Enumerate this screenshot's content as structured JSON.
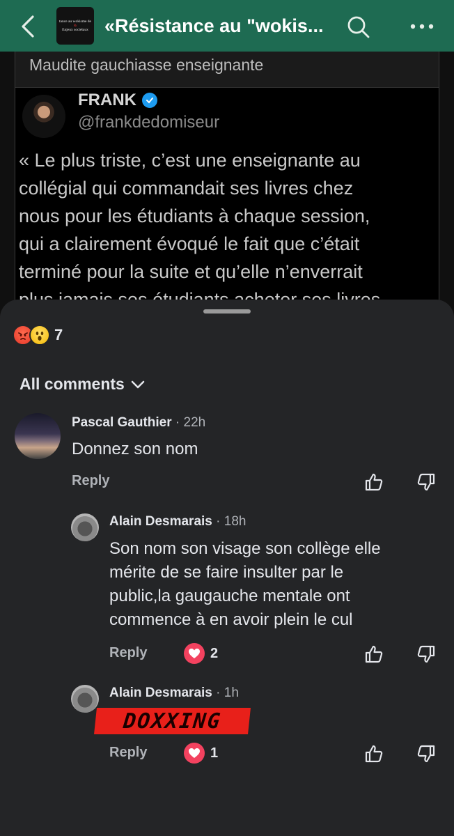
{
  "header": {
    "group_thumb_lines": [
      "tance au wokisme de",
      "&",
      "Enjeux sociétaux"
    ],
    "title": "«Résistance au \"wokis...",
    "colors": {
      "bar": "#1e6b52"
    }
  },
  "post": {
    "caption": "Maudite gauchiasse enseignante",
    "tweet": {
      "name": "FRANK",
      "handle": "@frankdedomiseur",
      "lines": [
        "« Le plus triste, c’est une enseignante au",
        "collégial qui commandait ses livres chez",
        "nous pour les étudiants à chaque session,",
        "qui a clairement évoqué le fait que c’était",
        "terminé pour la suite et qu’elle n’enverrait",
        "plus jamais ses étudiants acheter ses livres"
      ]
    }
  },
  "sheet": {
    "reaction_count": "7",
    "filter_label": "All comments",
    "comments": [
      {
        "name": "Pascal Gauthier",
        "time": "· 22h",
        "text": "Donnez son nom",
        "reply_label": "Reply"
      },
      {
        "name": "Alain Desmarais",
        "time": "· 18h",
        "text_lines": [
          "Son nom son visage son collège elle",
          "mérite de se faire insulter par le",
          "public,la gaugauche mentale ont",
          "commence à en avoir plein le cul"
        ],
        "reply_label": "Reply",
        "heart_count": "2"
      },
      {
        "name": "Alain Desmarais",
        "time": "· 1h",
        "redaction_text": "DOXXING",
        "reply_label": "Reply",
        "heart_count": "1"
      }
    ]
  }
}
